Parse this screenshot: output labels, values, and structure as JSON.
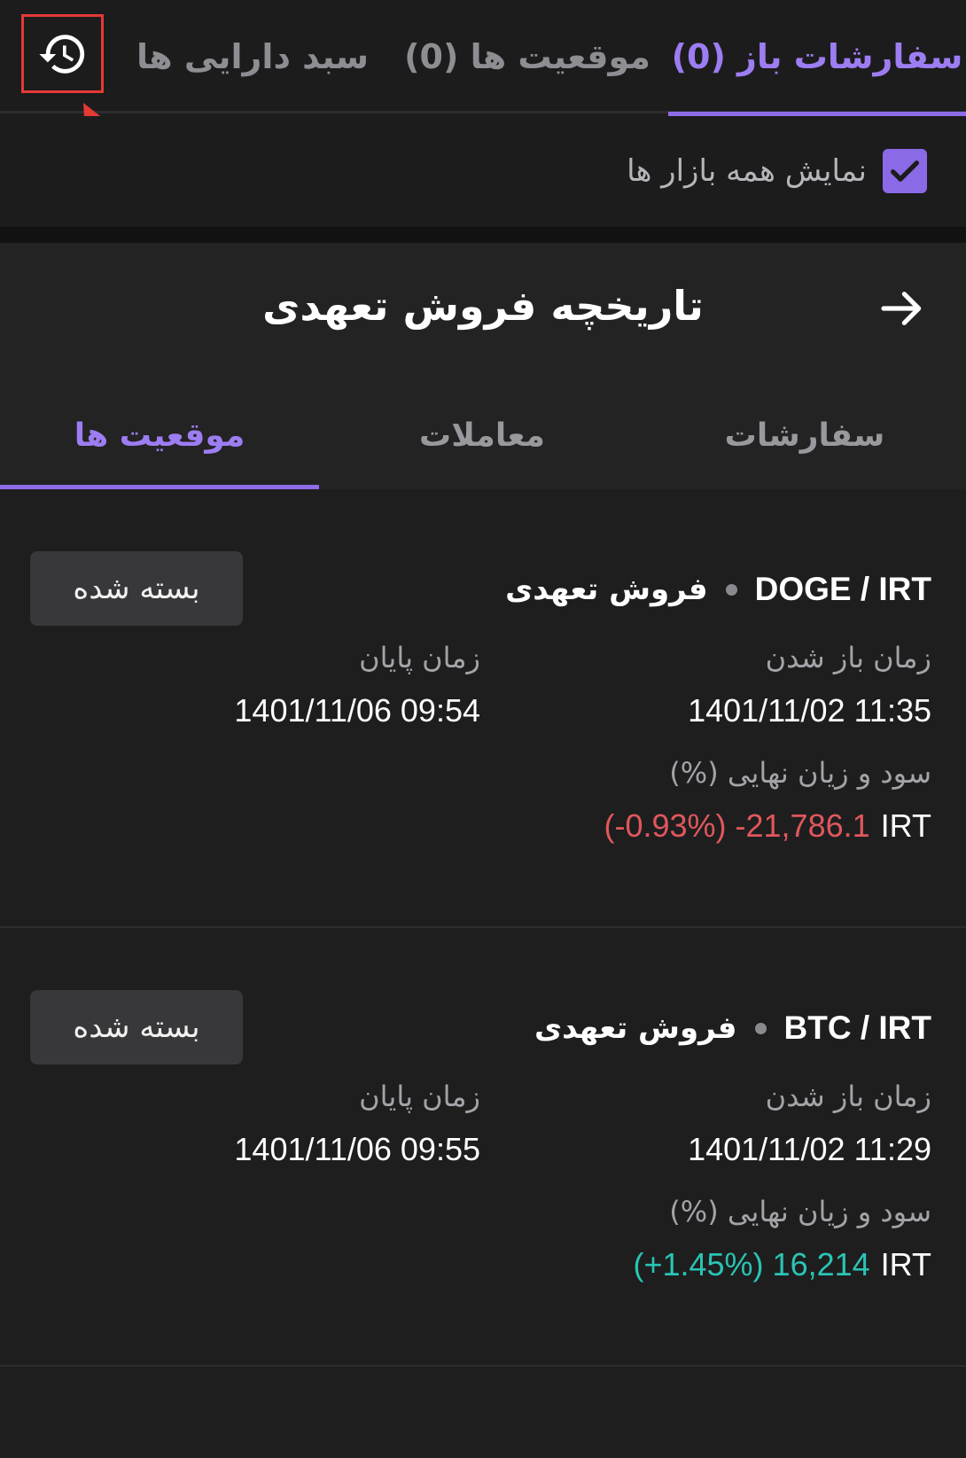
{
  "top_tabs": {
    "orders": "سفارشات باز (0)",
    "positions": "موقعیت ها (0)",
    "portfolio": "سبد دارایی ها"
  },
  "show_all_markets": {
    "label": "نمایش همه بازار ها",
    "checked": true
  },
  "sheet": {
    "title": "تاریخچه فروش تعهدی",
    "tabs": {
      "orders": "سفارشات",
      "trades": "معاملات",
      "positions": "موقعیت ها"
    },
    "active_tab": "positions"
  },
  "labels": {
    "open_time": "زمان باز شدن",
    "close_time": "زمان پایان",
    "final_pnl": "سود و زیان نهایی (%)"
  },
  "positions": [
    {
      "pair": "DOGE / IRT",
      "type": "فروش تعهدی",
      "status": "بسته شده",
      "open_time": "1401/11/02 11:35",
      "close_time": "1401/11/06 09:54",
      "pnl_text": "(-0.93%) -21,786.1",
      "pnl_currency": "IRT",
      "pnl_sign": "negative"
    },
    {
      "pair": "BTC / IRT",
      "type": "فروش تعهدی",
      "status": "بسته شده",
      "open_time": "1401/11/02 11:29",
      "close_time": "1401/11/06 09:55",
      "pnl_text": "(+1.45%) 16,214",
      "pnl_currency": "IRT",
      "pnl_sign": "positive"
    }
  ],
  "colors": {
    "accent": "#8f6be8",
    "negative": "#e0575c",
    "positive": "#2ac4b4",
    "highlight": "#e53935"
  },
  "icons": {
    "history": "history-icon",
    "back": "arrow-right-icon",
    "check": "check-icon"
  }
}
